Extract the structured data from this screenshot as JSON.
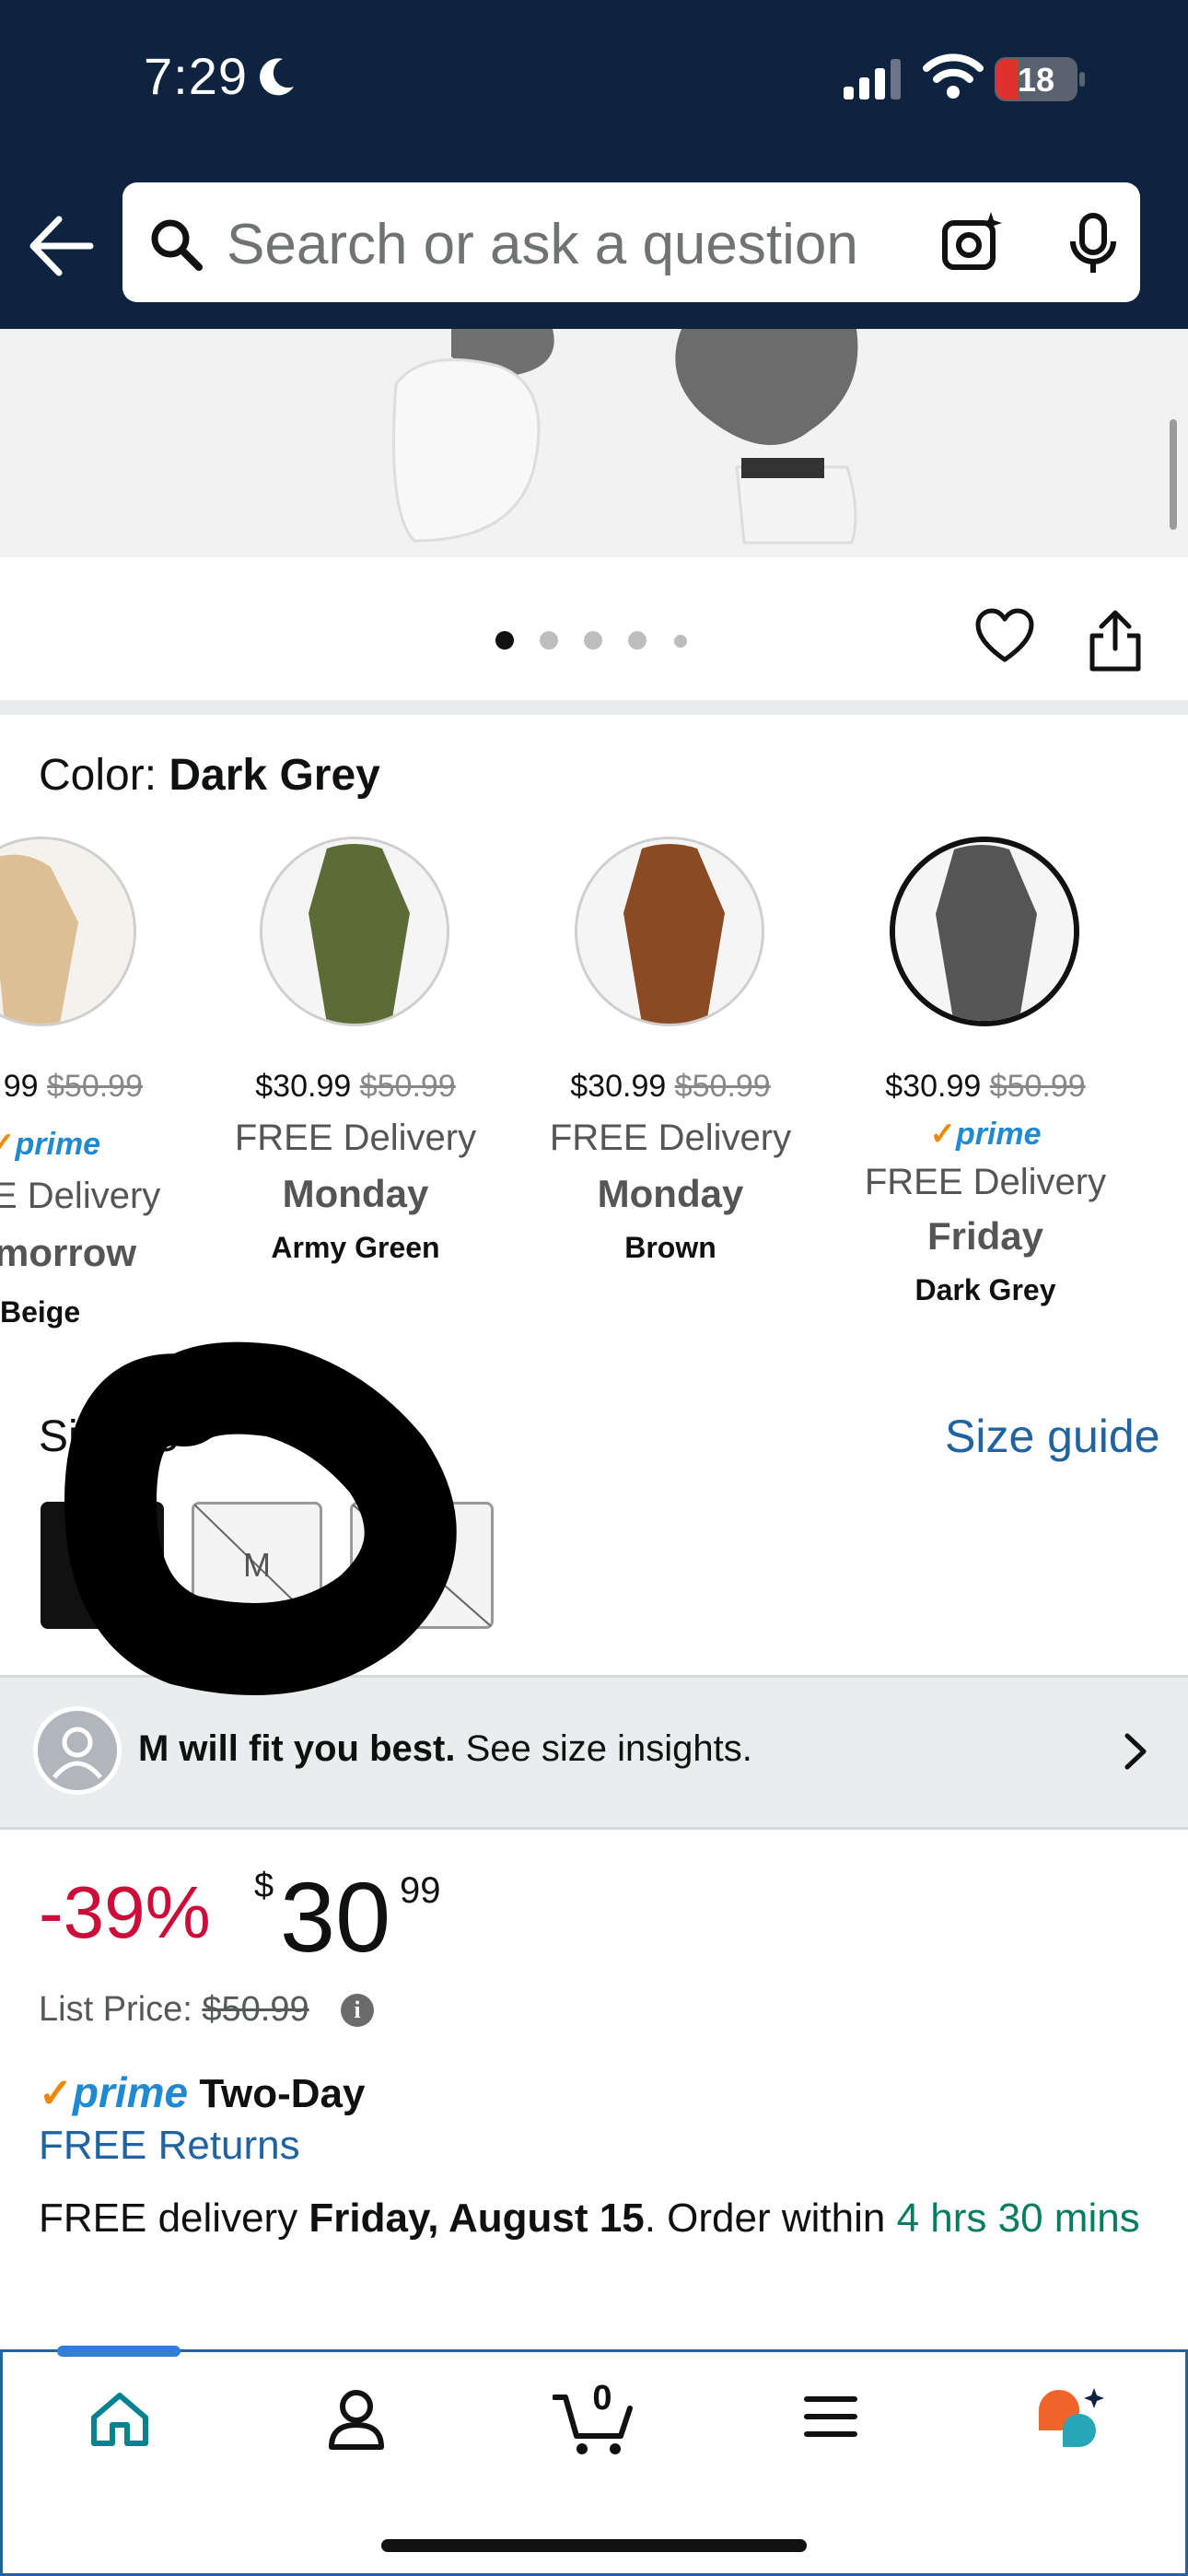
{
  "status": {
    "time": "7:29",
    "battery": "18"
  },
  "search": {
    "placeholder": "Search or ask a question"
  },
  "product": {
    "color_label": "Color: ",
    "color_value": "Dark Grey",
    "swatches": [
      {
        "price": "99",
        "old": "$50.99",
        "prime": "prime",
        "delivery": "E Delivery",
        "day": "morrow",
        "name": "Beige"
      },
      {
        "price": "$30.99",
        "old": "$50.99",
        "delivery": "FREE Delivery",
        "day": "Monday",
        "name": "Army Green"
      },
      {
        "price": "$30.99",
        "old": "$50.99",
        "delivery": "FREE Delivery",
        "day": "Monday",
        "name": "Brown"
      },
      {
        "price": "$30.99",
        "old": "$50.99",
        "prime": "prime",
        "delivery": "FREE Delivery",
        "day": "Friday",
        "name": "Dark Grey"
      }
    ],
    "size_label": "Size: S",
    "size_guide": "Size guide",
    "sizes": [
      "S",
      "M",
      "XL"
    ],
    "fit_bold": "M will fit you best.",
    "fit_rest": " See size insights.",
    "discount": "-39%",
    "currency": "$",
    "price_whole": "30",
    "price_cents": "99",
    "list_price_label": "List Price: ",
    "list_price": "$50.99",
    "prime": "prime",
    "two_day": "Two-Day",
    "free_returns": "FREE Returns",
    "delivery_prefix": "FREE delivery ",
    "delivery_date": "Friday, August 15",
    "delivery_mid": ". Order within ",
    "delivery_countdown": "4 hrs 30 mins"
  },
  "tabbar": {
    "cart_count": "0"
  }
}
